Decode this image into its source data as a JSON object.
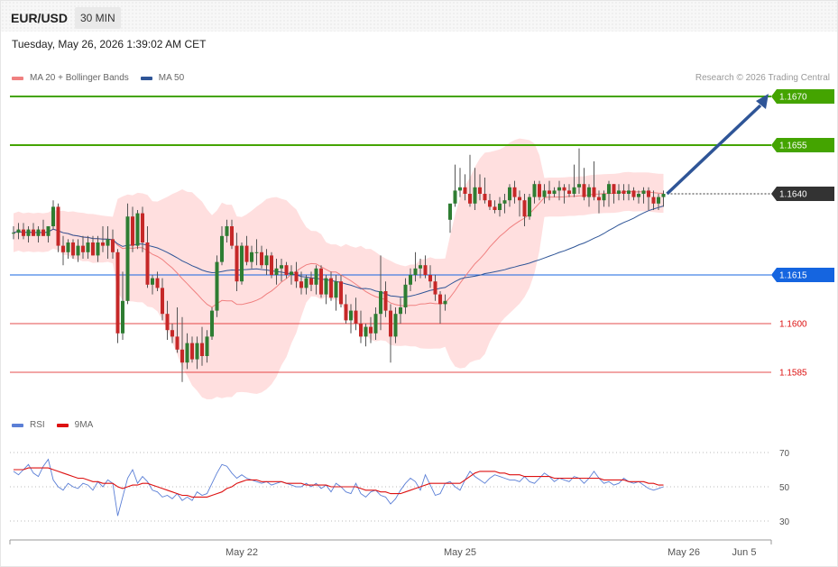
{
  "header": {
    "pair": "EUR/USD",
    "timeframe": "30 MIN",
    "datetime": "Tuesday, May 26, 2026 1:39:02 AM CET",
    "copyright": "Research © 2026 Trading Central"
  },
  "legend_main": [
    {
      "label": "MA 20 + Bollinger Bands",
      "color": "#f08080"
    },
    {
      "label": "MA 50",
      "color": "#2f5597"
    }
  ],
  "legend_rsi": [
    {
      "label": "RSI",
      "color": "#5b7fd6"
    },
    {
      "label": "9MA",
      "color": "#dd1111"
    }
  ],
  "chart_data": [
    {
      "type": "candlestick",
      "ylim": [
        1.1575,
        1.1677
      ],
      "grid": false,
      "levels": [
        {
          "value": 1.167,
          "label": "1.1670",
          "kind": "resistance",
          "color": "#44a400"
        },
        {
          "value": 1.1655,
          "label": "1.1655",
          "kind": "resistance",
          "color": "#44a400"
        },
        {
          "value": 1.164,
          "label": "1.1640",
          "kind": "pivot",
          "color": "#333333"
        },
        {
          "value": 1.1615,
          "label": "1.1615",
          "kind": "support",
          "color": "#1565e0"
        },
        {
          "value": 1.16,
          "label": "1.1600",
          "kind": "support",
          "color": "#dd1111"
        },
        {
          "value": 1.1585,
          "label": "1.1585",
          "kind": "support",
          "color": "#dd1111"
        }
      ],
      "forecast_arrow": {
        "from": 1.164,
        "to": 1.167,
        "direction": "up"
      },
      "x_ticks": [
        "May 22",
        "May 25",
        "May 26",
        "Jun 5"
      ],
      "candles": [
        [
          1.1628,
          1.163,
          1.1626,
          1.1628
        ],
        [
          1.1628,
          1.1631,
          1.1626,
          1.1629
        ],
        [
          1.1629,
          1.1631,
          1.1626,
          1.1627
        ],
        [
          1.1627,
          1.163,
          1.1625,
          1.1629
        ],
        [
          1.1629,
          1.1631,
          1.1627,
          1.1627
        ],
        [
          1.1627,
          1.163,
          1.1625,
          1.1629
        ],
        [
          1.1629,
          1.1632,
          1.1627,
          1.1627
        ],
        [
          1.1627,
          1.163,
          1.1625,
          1.163
        ],
        [
          1.163,
          1.1638,
          1.1629,
          1.1636
        ],
        [
          1.1636,
          1.1637,
          1.1622,
          1.1624
        ],
        [
          1.1624,
          1.1627,
          1.1618,
          1.1622
        ],
        [
          1.1622,
          1.1626,
          1.162,
          1.1625
        ],
        [
          1.1625,
          1.1626,
          1.162,
          1.1621
        ],
        [
          1.1621,
          1.1626,
          1.1619,
          1.1624
        ],
        [
          1.1624,
          1.1627,
          1.162,
          1.1622
        ],
        [
          1.1622,
          1.1627,
          1.162,
          1.1625
        ],
        [
          1.1625,
          1.1627,
          1.1621,
          1.1621
        ],
        [
          1.1621,
          1.1627,
          1.1619,
          1.1625
        ],
        [
          1.1625,
          1.163,
          1.1622,
          1.1624
        ],
        [
          1.1624,
          1.163,
          1.162,
          1.1626
        ],
        [
          1.1626,
          1.1629,
          1.162,
          1.1622
        ],
        [
          1.1622,
          1.1623,
          1.1594,
          1.1597
        ],
        [
          1.1597,
          1.1616,
          1.1595,
          1.1607
        ],
        [
          1.1607,
          1.1637,
          1.1606,
          1.1633
        ],
        [
          1.1633,
          1.1636,
          1.1622,
          1.1624
        ],
        [
          1.1624,
          1.1635,
          1.1623,
          1.1634
        ],
        [
          1.1634,
          1.1636,
          1.1622,
          1.1625
        ],
        [
          1.1625,
          1.163,
          1.1611,
          1.1612
        ],
        [
          1.1612,
          1.1615,
          1.1609,
          1.1614
        ],
        [
          1.1614,
          1.1616,
          1.161,
          1.1611
        ],
        [
          1.1611,
          1.1614,
          1.1601,
          1.1603
        ],
        [
          1.1603,
          1.1607,
          1.1595,
          1.1598
        ],
        [
          1.1598,
          1.16,
          1.1594,
          1.1596
        ],
        [
          1.1596,
          1.1605,
          1.1591,
          1.1592
        ],
        [
          1.1592,
          1.1602,
          1.1582,
          1.1588
        ],
        [
          1.1588,
          1.1597,
          1.1586,
          1.1594
        ],
        [
          1.1594,
          1.1596,
          1.1588,
          1.1589
        ],
        [
          1.1589,
          1.1596,
          1.1586,
          1.1594
        ],
        [
          1.1594,
          1.1599,
          1.1587,
          1.159
        ],
        [
          1.159,
          1.1598,
          1.1588,
          1.1596
        ],
        [
          1.1596,
          1.1605,
          1.1595,
          1.1604
        ],
        [
          1.1604,
          1.1621,
          1.1602,
          1.1619
        ],
        [
          1.1619,
          1.163,
          1.1618,
          1.1627
        ],
        [
          1.1627,
          1.1632,
          1.1625,
          1.163
        ],
        [
          1.163,
          1.1632,
          1.1623,
          1.1624
        ],
        [
          1.1624,
          1.1628,
          1.161,
          1.1613
        ],
        [
          1.1613,
          1.1625,
          1.1612,
          1.1624
        ],
        [
          1.1624,
          1.1627,
          1.1618,
          1.1619
        ],
        [
          1.1619,
          1.1624,
          1.1617,
          1.1622
        ],
        [
          1.1622,
          1.1626,
          1.1618,
          1.1622
        ],
        [
          1.1622,
          1.1624,
          1.1617,
          1.1618
        ],
        [
          1.1618,
          1.1623,
          1.1615,
          1.1621
        ],
        [
          1.1621,
          1.1622,
          1.1614,
          1.1615
        ],
        [
          1.1615,
          1.162,
          1.1612,
          1.1617
        ],
        [
          1.1617,
          1.162,
          1.1613,
          1.1618
        ],
        [
          1.1618,
          1.1619,
          1.1614,
          1.1615
        ],
        [
          1.1615,
          1.1618,
          1.1612,
          1.1616
        ],
        [
          1.1616,
          1.1619,
          1.1611,
          1.1613
        ],
        [
          1.1613,
          1.1616,
          1.1609,
          1.1611
        ],
        [
          1.1611,
          1.1615,
          1.1609,
          1.1614
        ],
        [
          1.1614,
          1.1616,
          1.161,
          1.1612
        ],
        [
          1.1612,
          1.1618,
          1.1609,
          1.1617
        ],
        [
          1.1617,
          1.1618,
          1.1608,
          1.1609
        ],
        [
          1.1609,
          1.1615,
          1.1606,
          1.1614
        ],
        [
          1.1614,
          1.1616,
          1.1607,
          1.1608
        ],
        [
          1.1608,
          1.1615,
          1.1604,
          1.1613
        ],
        [
          1.1613,
          1.1615,
          1.1605,
          1.1606
        ],
        [
          1.1606,
          1.1609,
          1.16,
          1.1601
        ],
        [
          1.1601,
          1.1606,
          1.1597,
          1.1604
        ],
        [
          1.1604,
          1.1608,
          1.1598,
          1.16
        ],
        [
          1.16,
          1.1604,
          1.1594,
          1.1596
        ],
        [
          1.1596,
          1.16,
          1.1593,
          1.1599
        ],
        [
          1.1599,
          1.1602,
          1.1594,
          1.1597
        ],
        [
          1.1597,
          1.1605,
          1.1595,
          1.1603
        ],
        [
          1.1603,
          1.1621,
          1.1598,
          1.161
        ],
        [
          1.161,
          1.1613,
          1.1602,
          1.1604
        ],
        [
          1.1604,
          1.1606,
          1.1588,
          1.1596
        ],
        [
          1.1596,
          1.1605,
          1.1594,
          1.1603
        ],
        [
          1.1603,
          1.1608,
          1.16,
          1.1605
        ],
        [
          1.1605,
          1.1614,
          1.1603,
          1.1612
        ],
        [
          1.1612,
          1.1617,
          1.161,
          1.1615
        ],
        [
          1.1615,
          1.1622,
          1.1613,
          1.1617
        ],
        [
          1.1617,
          1.162,
          1.1614,
          1.1618
        ],
        [
          1.1618,
          1.1621,
          1.1614,
          1.1615
        ],
        [
          1.1615,
          1.1618,
          1.1611,
          1.1613
        ],
        [
          1.1613,
          1.1615,
          1.1607,
          1.1609
        ],
        [
          1.1609,
          1.161,
          1.16,
          1.1606
        ],
        [
          1.1606,
          1.1609,
          1.1604,
          1.1607
        ],
        [
          1.1632,
          1.1636,
          1.1628,
          1.1637
        ],
        [
          1.1637,
          1.1649,
          1.1636,
          1.1641
        ],
        [
          1.1641,
          1.1648,
          1.1639,
          1.1642
        ],
        [
          1.1642,
          1.1646,
          1.1638,
          1.164
        ],
        [
          1.164,
          1.1652,
          1.1636,
          1.1637
        ],
        [
          1.1637,
          1.1648,
          1.1635,
          1.1642
        ],
        [
          1.1642,
          1.1646,
          1.1638,
          1.164
        ],
        [
          1.164,
          1.1645,
          1.1637,
          1.1638
        ],
        [
          1.1638,
          1.164,
          1.1635,
          1.1636
        ],
        [
          1.1636,
          1.1638,
          1.1634,
          1.1635
        ],
        [
          1.1635,
          1.1639,
          1.1633,
          1.1637
        ],
        [
          1.1637,
          1.164,
          1.1634,
          1.1638
        ],
        [
          1.1638,
          1.1643,
          1.1636,
          1.1642
        ],
        [
          1.1642,
          1.1644,
          1.1637,
          1.1639
        ],
        [
          1.1639,
          1.1641,
          1.1633,
          1.1638
        ],
        [
          1.1638,
          1.164,
          1.163,
          1.1633
        ],
        [
          1.1633,
          1.164,
          1.1632,
          1.1639
        ],
        [
          1.1639,
          1.1644,
          1.1637,
          1.1643
        ],
        [
          1.1643,
          1.1644,
          1.1638,
          1.1639
        ],
        [
          1.1639,
          1.1643,
          1.1637,
          1.1641
        ],
        [
          1.1641,
          1.1644,
          1.1638,
          1.164
        ],
        [
          1.164,
          1.1642,
          1.1639,
          1.1641
        ],
        [
          1.1641,
          1.1644,
          1.1638,
          1.1642
        ],
        [
          1.1642,
          1.1643,
          1.1637,
          1.1641
        ],
        [
          1.1641,
          1.1643,
          1.1639,
          1.164
        ],
        [
          1.164,
          1.1649,
          1.1639,
          1.1642
        ],
        [
          1.1642,
          1.1654,
          1.164,
          1.1643
        ],
        [
          1.1643,
          1.1648,
          1.1638,
          1.1639
        ],
        [
          1.1639,
          1.1643,
          1.1636,
          1.1642
        ],
        [
          1.1642,
          1.165,
          1.1638,
          1.1639
        ],
        [
          1.1639,
          1.1641,
          1.1634,
          1.1638
        ],
        [
          1.1638,
          1.1641,
          1.1636,
          1.164
        ],
        [
          1.164,
          1.1644,
          1.1636,
          1.1643
        ],
        [
          1.1643,
          1.1643,
          1.1637,
          1.164
        ],
        [
          1.164,
          1.1643,
          1.1638,
          1.1641
        ],
        [
          1.1641,
          1.1643,
          1.1638,
          1.164
        ],
        [
          1.164,
          1.1643,
          1.1638,
          1.1641
        ],
        [
          1.1641,
          1.1642,
          1.1638,
          1.1639
        ],
        [
          1.1639,
          1.1641,
          1.1637,
          1.164
        ],
        [
          1.164,
          1.1642,
          1.1637,
          1.1641
        ],
        [
          1.1641,
          1.1642,
          1.1635,
          1.1639
        ],
        [
          1.1639,
          1.1641,
          1.1635,
          1.1637
        ],
        [
          1.1637,
          1.164,
          1.1635,
          1.1639
        ],
        [
          1.1639,
          1.1641,
          1.1636,
          1.164
        ]
      ]
    },
    {
      "type": "line",
      "panel": "RSI",
      "ylim": [
        20,
        78
      ],
      "y_ticks": [
        70,
        50,
        30
      ],
      "series": [
        {
          "name": "RSI",
          "color": "#5b7fd6",
          "values": [
            59,
            57,
            60,
            63,
            58,
            56,
            62,
            66,
            54,
            50,
            48,
            52,
            50,
            49,
            52,
            51,
            48,
            53,
            50,
            54,
            52,
            33,
            44,
            55,
            60,
            52,
            56,
            53,
            48,
            47,
            44,
            45,
            43,
            46,
            42,
            44,
            42,
            47,
            45,
            46,
            52,
            58,
            63,
            62,
            58,
            55,
            57,
            55,
            54,
            53,
            52,
            53,
            51,
            52,
            53,
            52,
            51,
            50,
            50,
            52,
            50,
            52,
            49,
            51,
            47,
            52,
            50,
            47,
            46,
            52,
            46,
            44,
            47,
            48,
            45,
            44,
            40,
            43,
            48,
            52,
            55,
            53,
            48,
            57,
            51,
            45,
            46,
            52,
            53,
            50,
            48,
            54,
            59,
            56,
            54,
            52,
            55,
            57,
            56,
            55,
            54,
            54,
            53,
            56,
            53,
            52,
            55,
            58,
            56,
            53,
            55,
            54,
            53,
            56,
            55,
            52,
            55,
            59,
            55,
            52,
            53,
            51,
            52,
            55,
            53,
            52,
            53,
            51,
            49,
            48,
            49,
            50
          ]
        },
        {
          "name": "9MA",
          "color": "#dd1111",
          "values": [
            60,
            60,
            60,
            61,
            61,
            61,
            61,
            61,
            60,
            59,
            58,
            57,
            56,
            55,
            55,
            54,
            53,
            53,
            52,
            52,
            52,
            50,
            49,
            50,
            51,
            51,
            52,
            52,
            51,
            50,
            49,
            48,
            47,
            46,
            45,
            45,
            44,
            44,
            44,
            44,
            45,
            46,
            47,
            49,
            50,
            52,
            53,
            54,
            54,
            54,
            53,
            53,
            53,
            53,
            53,
            52,
            52,
            52,
            52,
            51,
            51,
            51,
            51,
            51,
            50,
            50,
            50,
            50,
            50,
            50,
            49,
            48,
            48,
            48,
            47,
            47,
            46,
            46,
            46,
            47,
            48,
            49,
            50,
            51,
            52,
            52,
            52,
            52,
            52,
            52,
            52,
            54,
            56,
            58,
            59,
            59,
            59,
            59,
            58,
            58,
            57,
            57,
            57,
            56,
            56,
            56,
            56,
            56,
            56,
            55,
            55,
            55,
            55,
            55,
            55,
            55,
            55,
            55,
            55,
            54,
            54,
            54,
            54,
            54,
            53,
            53,
            53,
            53,
            52,
            52,
            51,
            51
          ]
        }
      ]
    }
  ]
}
